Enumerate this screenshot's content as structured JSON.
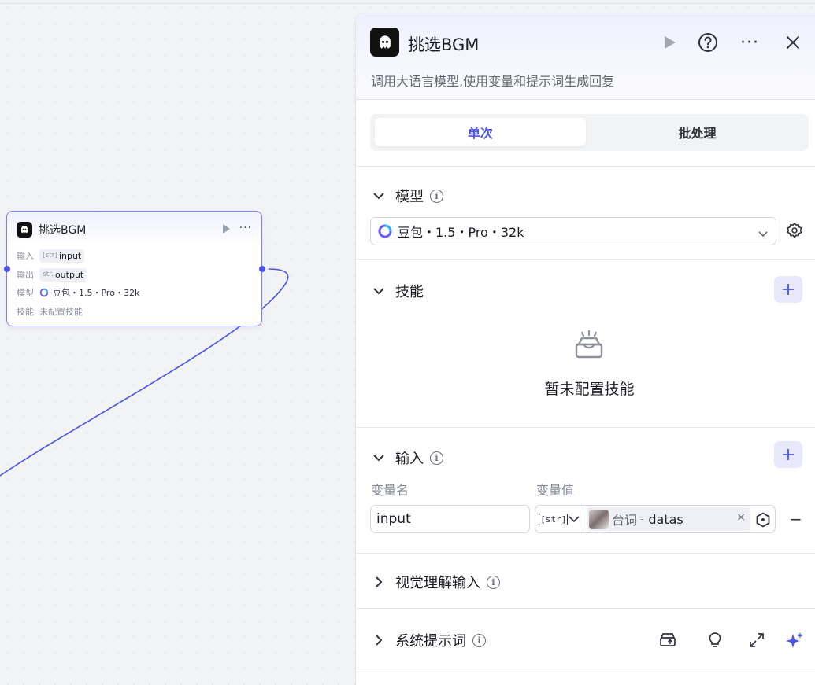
{
  "node": {
    "title": "挑选BGM",
    "rows": {
      "input_label": "输入",
      "input_type": "[str]",
      "input_value": "input",
      "output_label": "输出",
      "output_type": "str.",
      "output_value": "output",
      "model_label": "模型",
      "model_value": "豆包・1.5・Pro・32k",
      "skills_label": "技能",
      "skills_value": "未配置技能"
    }
  },
  "panel": {
    "title": "挑选BGM",
    "description": "调用大语言模型,使用变量和提示词生成回复",
    "tabs": {
      "single": "单次",
      "batch": "批处理"
    },
    "model_section": {
      "title": "模型",
      "selected": "豆包・1.5・Pro・32k"
    },
    "skills_section": {
      "title": "技能",
      "empty_text": "暂未配置技能"
    },
    "input_section": {
      "title": "输入",
      "col_name": "变量名",
      "col_value": "变量值",
      "row": {
        "name": "input",
        "type_tag": "[str]",
        "source": "台词",
        "separator": "-",
        "variable": "datas",
        "remove_glyph": "×",
        "delete_glyph": "−"
      }
    },
    "vision_section": {
      "title": "视觉理解输入"
    },
    "system_prompt_section": {
      "title": "系统提示词"
    }
  },
  "colors": {
    "accent": "#4d53e8",
    "edge": "#4d53e8",
    "add_button_bg": "#e7e8fb"
  },
  "icons": [
    "robot-logo-icon",
    "run-icon",
    "help-icon",
    "more-icon",
    "close-icon",
    "chevron-down-icon",
    "chevron-right-icon",
    "info-icon",
    "gear-icon",
    "plus-icon",
    "empty-box-icon",
    "hexagon-icon",
    "template-icon",
    "bulb-icon",
    "expand-icon",
    "sparkle-icon"
  ]
}
